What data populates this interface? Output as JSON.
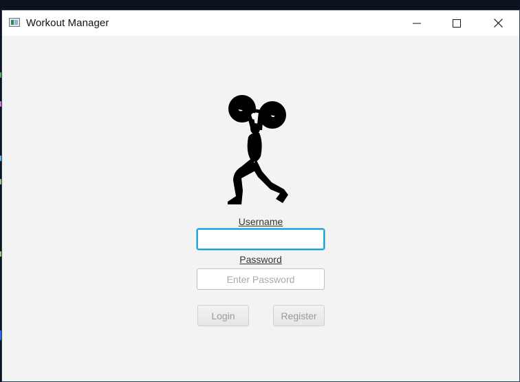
{
  "window": {
    "title": "Workout Manager",
    "icon": "app-window-icon",
    "controls": {
      "minimize_icon": "minimize-icon",
      "maximize_icon": "maximize-icon",
      "close_icon": "close-icon"
    }
  },
  "login_form": {
    "logo_icon": "weightlifter-icon",
    "username_label": "Username",
    "username_value": "",
    "username_placeholder": "",
    "password_label": "Password",
    "password_value": "",
    "password_placeholder": "Enter Password",
    "login_button": "Login",
    "register_button": "Register"
  },
  "colors": {
    "window_background": "#f3f3f3",
    "focus_border": "#0096c9",
    "disabled_text": "#9a9a9a"
  }
}
